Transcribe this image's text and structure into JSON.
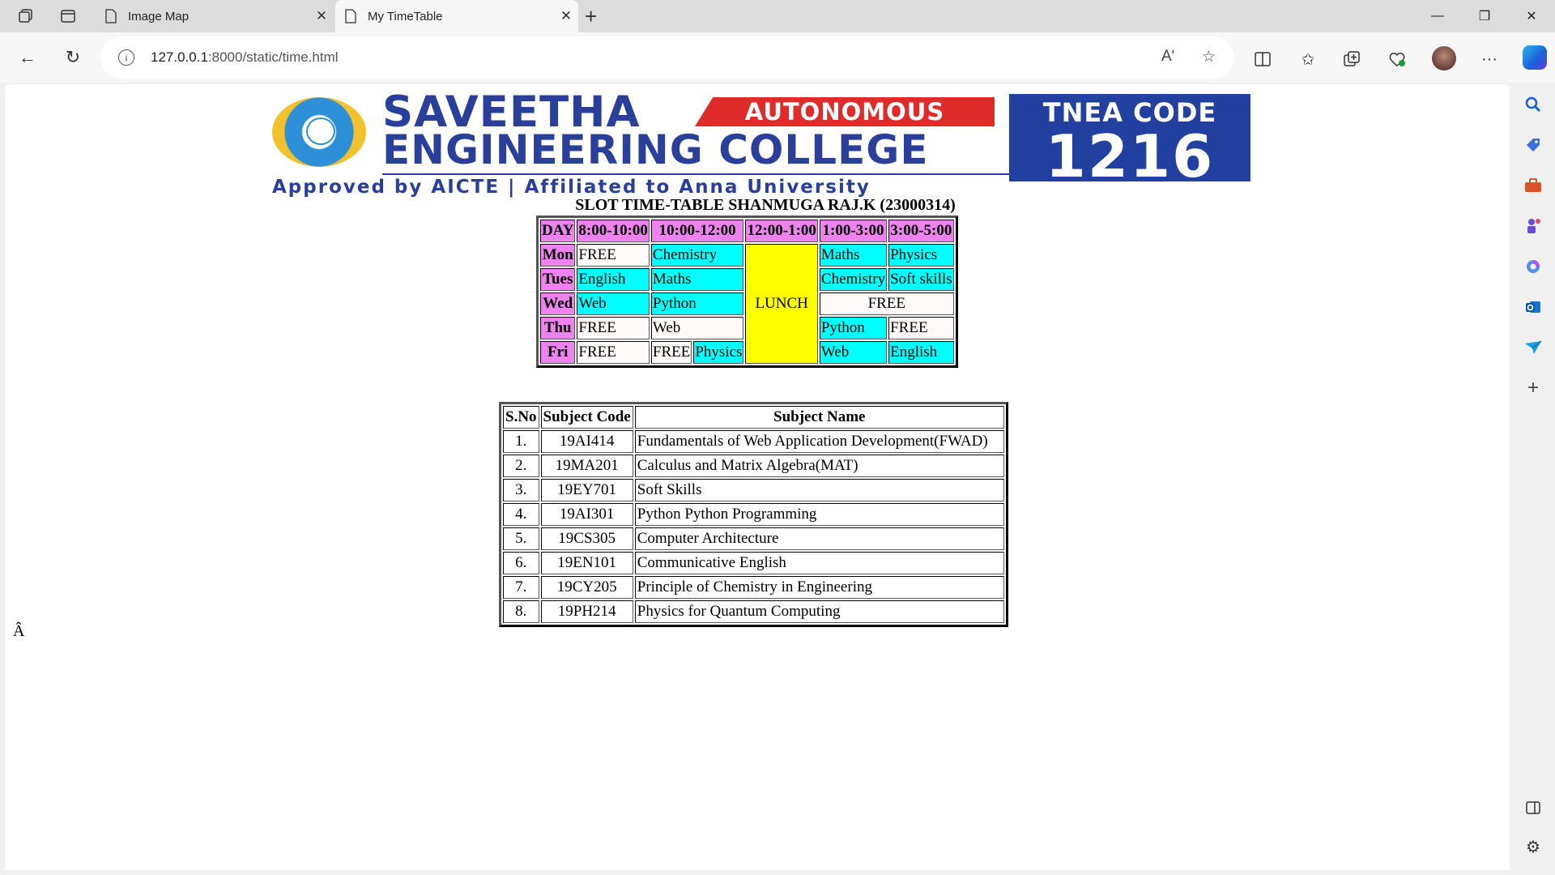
{
  "browser": {
    "tabs": [
      {
        "title": "Image Map",
        "active": false
      },
      {
        "title": "My TimeTable",
        "active": true
      }
    ],
    "url_host": "127.0.0.1",
    "url_rest": ":8000/static/time.html",
    "read_aloud_label": "Aʹ"
  },
  "banner": {
    "college_line1": "SAVEETHA",
    "college_line2": "ENGINEERING COLLEGE",
    "autonomous": "AUTONOMOUS",
    "approved": "Approved by AICTE  |  Affiliated to Anna University",
    "tnea_label": "TNEA CODE",
    "tnea_code": "1216"
  },
  "timetable": {
    "caption": "SLOT TIME-TABLE SHANMUGA RAJ.K (23000314)",
    "headers": [
      "DAY",
      "8:00-10:00",
      "10:00-12:00",
      "12:00-1:00",
      "1:00-3:00",
      "3:00-5:00"
    ],
    "lunch": "LUNCH",
    "rows": {
      "mon": {
        "day": "Mon",
        "s1": "FREE",
        "s2": "Chemistry",
        "s4": "Maths",
        "s5": "Physics"
      },
      "tue": {
        "day": "Tues",
        "s1": "English",
        "s2": "Maths",
        "s4": "Chemistry",
        "s5": "Soft skills"
      },
      "wed": {
        "day": "Wed",
        "s1": "Web",
        "s2": "Python",
        "s45": "FREE"
      },
      "thu": {
        "day": "Thu",
        "s1": "FREE",
        "s2": "Web",
        "s4": "Python",
        "s5": "FREE"
      },
      "fri": {
        "day": "Fri",
        "s1": "FREE",
        "s2a": "FREE",
        "s2b": "Physics",
        "s4": "Web",
        "s5": "English"
      }
    }
  },
  "subjects": {
    "headers": [
      "S.No",
      "Subject Code",
      "Subject Name"
    ],
    "rows": [
      {
        "no": "1.",
        "code": "19AI414",
        "name": "Fundamentals of Web Application Development(FWAD)"
      },
      {
        "no": "2.",
        "code": "19MA201",
        "name": "Calculus and Matrix Algebra(MAT)"
      },
      {
        "no": "3.",
        "code": "19EY701",
        "name": "Soft Skills"
      },
      {
        "no": "4.",
        "code": "19AI301",
        "name": "Python Python Programming"
      },
      {
        "no": "5.",
        "code": "19CS305",
        "name": "Computer Architecture"
      },
      {
        "no": "6.",
        "code": "19EN101",
        "name": "Communicative English"
      },
      {
        "no": "7.",
        "code": "19CY205",
        "name": "Principle of Chemistry in Engineering"
      },
      {
        "no": "8.",
        "code": "19PH214",
        "name": "Physics for Quantum Computing"
      }
    ]
  },
  "stray_char": "Â",
  "colors": {
    "header": "#ee82ee",
    "cell": "#00ffff",
    "free": "#fffafa",
    "lunch": "#ffff00",
    "brand_blue": "#2a3f9a",
    "brand_red": "#e02b2b"
  }
}
